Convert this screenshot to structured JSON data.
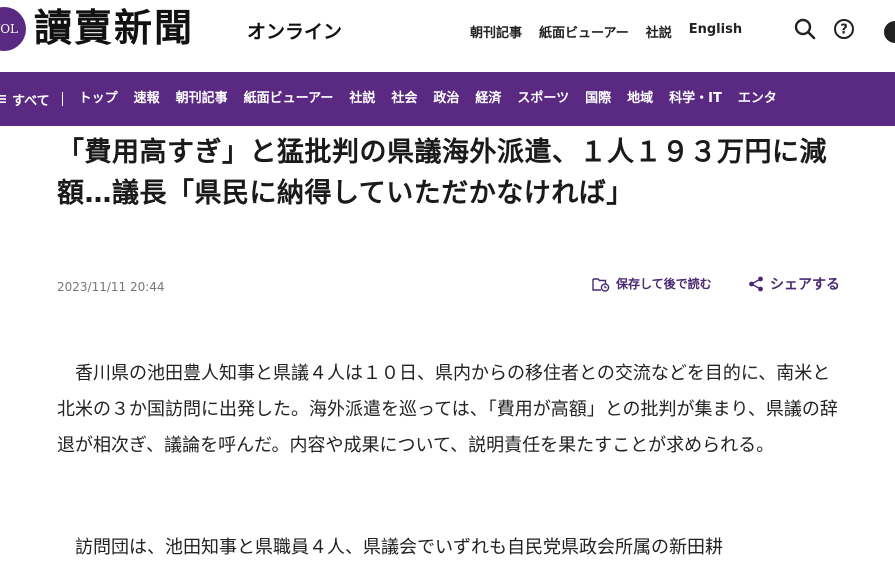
{
  "header": {
    "logo_badge": "YOL",
    "logo_text": "讀賣新聞",
    "logo_sub": "オンライン",
    "links": [
      "朝刊記事",
      "紙面ビューアー",
      "社説",
      "English"
    ],
    "icons": [
      "search-icon",
      "help-icon",
      "user-icon"
    ]
  },
  "nav": {
    "all_label": "すべて",
    "items": [
      "トップ",
      "速報",
      "朝刊記事",
      "紙面ビューアー",
      "社説",
      "社会",
      "政治",
      "経済",
      "スポーツ",
      "国際",
      "地域",
      "科学・IT",
      "エンタ"
    ]
  },
  "colors": {
    "brand": "#5a2a82",
    "accent_text": "#4a2a72"
  },
  "article": {
    "headline": "「費用高すぎ」と猛批判の県議海外派遣、１人１９３万円に減額…議長「県民に納得していただかなければ」",
    "date": "2023/11/11 20:44",
    "save_label": "保存して後で読む",
    "share_label": "シェアする",
    "paragraphs": [
      "香川県の池田豊人知事と県議４人は１０日、県内からの移住者との交流などを目的に、南米と北米の３か国訪問に出発した。海外派遣を巡っては、「費用が高額」との批判が集まり、県議の辞退が相次ぎ、議論を呼んだ。内容や成果について、説明責任を果たすことが求められる。",
      "訪問団は、池田知事と県職員４人、県議会でいずれも自民党県政会所属の新田耕"
    ]
  }
}
